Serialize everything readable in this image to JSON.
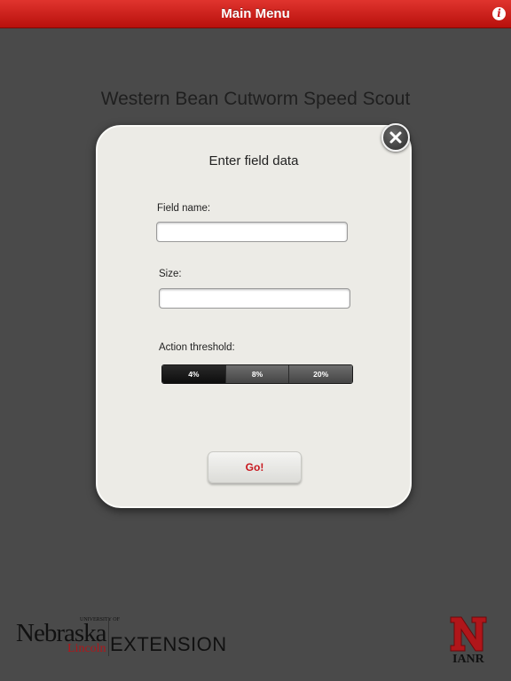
{
  "topbar": {
    "title": "Main Menu",
    "info_icon": "info-icon",
    "info_label": "i",
    "color": "#c8161d"
  },
  "page": {
    "title": "Western Bean Cutworm Speed Scout"
  },
  "modal": {
    "title": "Enter field data",
    "close_icon": "close-icon",
    "field_name": {
      "label": "Field name:",
      "value": "",
      "placeholder": ""
    },
    "size": {
      "label": "Size:",
      "value": "",
      "placeholder": ""
    },
    "threshold": {
      "label": "Action threshold:",
      "options": [
        "4%",
        "8%",
        "20%"
      ],
      "selected": "4%"
    },
    "go_label": "Go!"
  },
  "footer": {
    "unl_logo": {
      "wordmark": "Nebraska",
      "university": "UNIVERSITY OF",
      "lincoln": "Lincoln",
      "extension": "EXTENSION"
    },
    "ianr_logo": {
      "text": "IANR"
    }
  }
}
